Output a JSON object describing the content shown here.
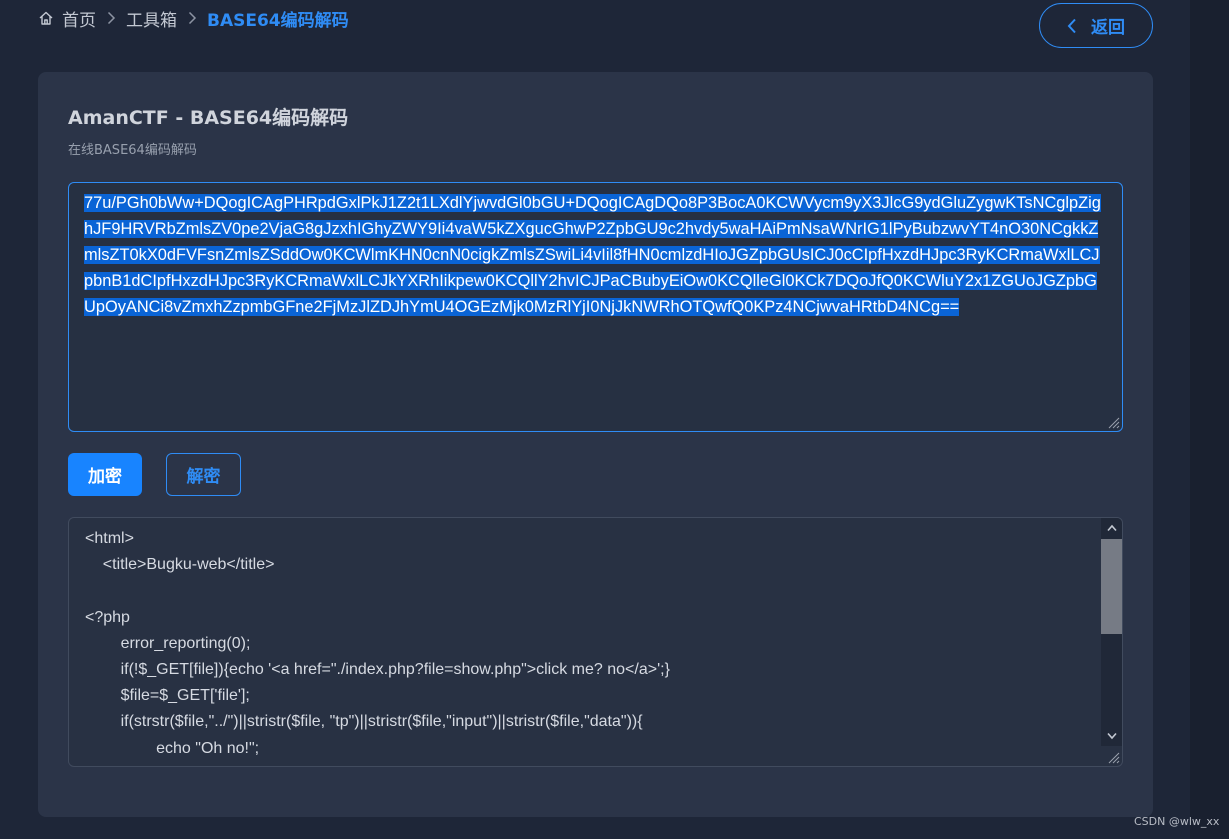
{
  "breadcrumb": {
    "home": "首页",
    "toolbox": "工具箱",
    "current": "BASE64编码解码"
  },
  "back_button": {
    "label": "返回"
  },
  "card": {
    "title": "AmanCTF - BASE64编码解码",
    "subtitle": "在线BASE64编码解码"
  },
  "input": {
    "value": "77u/PGh0bWw+DQogICAgPHRpdGxlPkJ1Z2t1LXdlYjwvdGl0bGU+DQogICAgDQo8P3BocA0KCWVycm9yX3JlcG9ydGluZygwKTsNCglpZighJF9HRVRbZmlsZV0pe2VjaG8gJzxhIGhyZWY9Ii4vaW5kZXgucGhwP2ZpbGU9c2hvdy5waHAiPmNsaWNrIG1lPyBubzwvYT4nO30NCgkkZmlsZT0kX0dFVFsnZmlsZSddOw0KCWlmKHN0cnN0cigkZmlsZSwiLi4vIil8fHN0cmlzdHIoJGZpbGUsICJ0cCIpfHxzdHJpc3RyKCRmaWxlLCJpbnB1dCIpfHxzdHJpc3RyKCRmaWxlLCJkYXRhIikpew0KCQllY2hvICJPaCBubyEiOw0KCQlleGl0KCk7DQoJfQ0KCWluY2x1ZGUoJGZpbGUpOyANCi8vZmxhZzpmbGFne2FjMzJlZDJhYmU4OGEzMjk0MzRlYjI0NjJkNWRhOTQwfQ0KPz4NCjwvaHRtbD4NCg=="
  },
  "buttons": {
    "encode": "加密",
    "decode": "解密"
  },
  "output": {
    "lines": [
      "<html>",
      "    <title>Bugku-web</title>",
      "",
      "<?php",
      "        error_reporting(0);",
      "        if(!$_GET[file]){echo '<a href=\"./index.php?file=show.php\">click me? no</a>';}",
      "        $file=$_GET['file'];",
      "        if(strstr($file,\"../\")||stristr($file, \"tp\")||stristr($file,\"input\")||stristr($file,\"data\")){",
      "                echo \"Oh no!\";"
    ]
  },
  "scrollbar": {
    "position": 0.0
  },
  "watermark": "CSDN @wlw_xx",
  "colors": {
    "accent": "#2f8cf5",
    "background": "#1e2638",
    "card": "#2b3448",
    "selection": "#0a64d6"
  }
}
